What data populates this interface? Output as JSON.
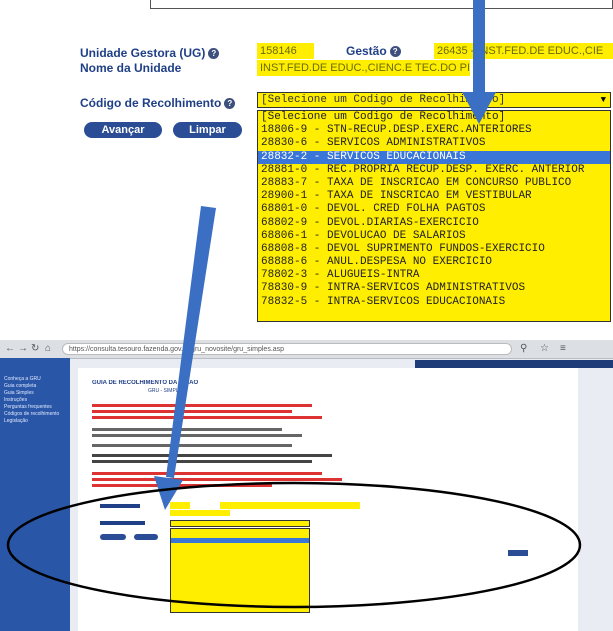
{
  "form": {
    "ug_label": "Unidade Gestora (UG)",
    "ug_value": "158146",
    "gestao_label": "Gestão",
    "gestao_value": "26435 - INST.FED.DE EDUC.,CIE",
    "nome_label": "Nome da Unidade",
    "nome_value": "INST.FED.DE EDUC.,CIENC.E TEC.DO PIAUI",
    "codigo_label": "Código de Recolhimento",
    "select_value": "[Selecione um Codigo de Recolhimento]",
    "avancar_label": "Avançar",
    "limpar_label": "Limpar",
    "options": [
      "[Selecione um Codigo de Recolhimento]",
      "18806-9 - STN-RECUP.DESP.EXERC.ANTERIORES",
      "28830-6 - SERVICOS ADMINISTRATIVOS",
      "28832-2 - SERVICOS EDUCACIONAIS",
      "28881-0 - REC.PROPRIA RECUP.DESP. EXERC. ANTERIOR",
      "28883-7 - TAXA DE INSCRICAO EM CONCURSO PUBLICO",
      "28900-1 - TAXA DE INSCRICAO EM VESTIBULAR",
      "68801-0 - DEVOL. CRED FOLHA PAGTOS",
      "68802-9 - DEVOL.DIARIAS-EXERCICIO",
      "68806-1 - DEVOLUCAO DE SALARIOS",
      "68808-8 - DEVOL SUPRIMENTO FUNDOS-EXERCICIO",
      "68888-6 - ANUL.DESPESA NO EXERCICIO",
      "78802-3 - ALUGUEIS-INTRA",
      "78830-9 - INTRA-SERVICOS ADMINISTRATIVOS",
      "78832-5 - INTRA-SERVICOS EDUCACIONAIS"
    ],
    "selected_index": 3,
    "help_icon": "question-circle-icon"
  },
  "browser": {
    "url": "https://consulta.tesouro.fazenda.gov.br/gru_novosite/gru_simples.asp",
    "nav_icons": [
      "back-arrow-icon",
      "forward-arrow-icon",
      "reload-icon",
      "home-icon"
    ],
    "page_heading": "GUIA DE RECOLHIMENTO DA UNIÃO",
    "page_subheading": "GRU - SIMPLES",
    "sidebar_items": [
      "Conheça a GRU",
      "Guia completa",
      "Guia Simples",
      "Instruções",
      "Perguntas frequentes",
      "Códigos de recolhimento",
      "Legislação"
    ]
  },
  "colors": {
    "label_blue": "#1f3f86",
    "field_yellow": "#ffee00",
    "button_blue": "#2a4d95",
    "selected_blue": "#3a76d8",
    "arrow_blue": "#3a6fc4"
  }
}
